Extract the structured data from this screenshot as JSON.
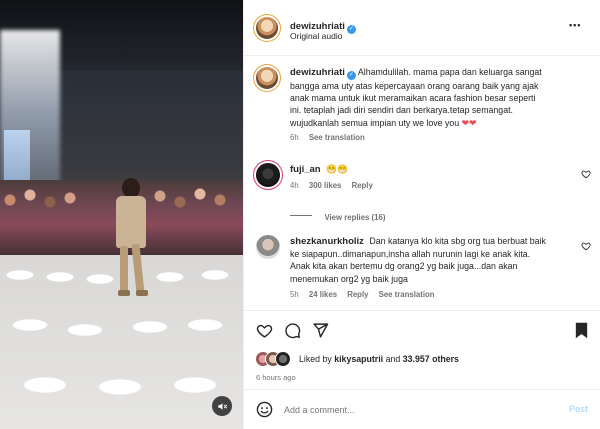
{
  "post": {
    "author": "dewizuhriati",
    "audio": "Original audio",
    "more_label": "•••"
  },
  "caption": {
    "username": "dewizuhriati",
    "text_lines": [
      "Alhamdulilah. mama papa dan keluarga sangat",
      "bangga ama uty atas kepercayaan orang oarang baik yang ajak",
      "anak mama untuk ikut meramaikan acara fashion besar seperti",
      "ini. tetaplah jadi diri sendiri dan berkarya.tetap semangat.",
      "wujudkanlah semua impian uty we love you"
    ],
    "hearts": "❤❤",
    "time": "6h",
    "see_translation": "See translation"
  },
  "comments": [
    {
      "username": "fuji_an",
      "text": "😁😁",
      "time": "4h",
      "likes": "300 likes",
      "reply": "Reply",
      "view_replies": "View replies (16)"
    },
    {
      "username": "shezkanurkholiz",
      "text_lines": [
        "Dan katanya klo kita sbg org tua berbuat baik",
        "ke siapapun..dimanapun,insha allah nurunin lagi ke anak kita.",
        "Anak kita akan bertemu dg orang2 yg baik juga...dan akan",
        "menemukan org2 yg baik juga"
      ],
      "time": "5h",
      "likes": "24 likes",
      "reply": "Reply",
      "see_translation": "See translation"
    }
  ],
  "engagement": {
    "liked_by_prefix": "Liked by",
    "liked_by_user": "kikysaputrii",
    "and_word": "and",
    "others": "33.957 others",
    "time_ago": "6 hours ago"
  },
  "comment_box": {
    "placeholder": "Add a comment...",
    "post_label": "Post"
  },
  "colors": {
    "verified": "#3897f0",
    "heart": "#ed4956",
    "muted_text": "#737373",
    "post_disabled": "#b3dbff"
  },
  "icons": {
    "like": "heart-outline-icon",
    "comment": "speech-bubble-icon",
    "share": "paper-plane-icon",
    "save": "bookmark-icon",
    "emoji": "smiley-icon",
    "mute": "speaker-muted-icon",
    "more": "more-horizontal-icon"
  }
}
